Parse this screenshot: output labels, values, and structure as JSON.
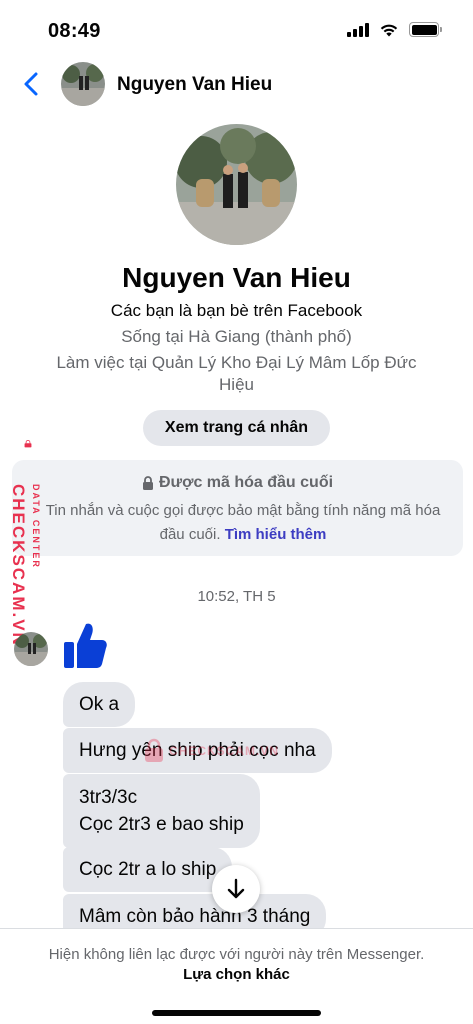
{
  "status_bar": {
    "time": "08:49"
  },
  "header": {
    "contact_name": "Nguyen Van Hieu"
  },
  "profile": {
    "name": "Nguyen Van Hieu",
    "friend_status": "Các bạn là bạn bè trên Facebook",
    "lives_in": "Sống tại Hà Giang (thành phố)",
    "works_at": "Làm việc tại Quản Lý Kho Đại Lý Mâm Lốp Đức Hiệu",
    "view_profile_label": "Xem trang cá nhân"
  },
  "encryption": {
    "title": "Được mã hóa đầu cuối",
    "description": "Tin nhắn và cuộc gọi được bảo mật bằng tính năng mã hóa đầu cuối.",
    "link": "Tìm hiểu thêm"
  },
  "chat": {
    "timestamp": "10:52, TH 5",
    "messages": [
      {
        "text": "Ok a"
      },
      {
        "text": "Hưng yên ship phải cọc nha"
      },
      {
        "lines": [
          "3tr3/3c",
          "Cọc 2tr3 e bao ship"
        ]
      },
      {
        "text": "Cọc 2tr a lo ship"
      },
      {
        "text": "Mâm còn bảo hành 3 tháng"
      }
    ]
  },
  "footer": {
    "text": "Hiện không liên lạc được với người này trên Messenger.",
    "link": "Lựa chọn khác"
  },
  "watermark": {
    "side_main": "CHECKSCAM.VN",
    "side_sub": "DATA CENTER",
    "center": "CHECKSCAM.VN"
  },
  "colors": {
    "accent": "#0866ff",
    "bubble": "#e4e6eb",
    "link": "#3d3dc2",
    "watermark": "#e8314f"
  }
}
